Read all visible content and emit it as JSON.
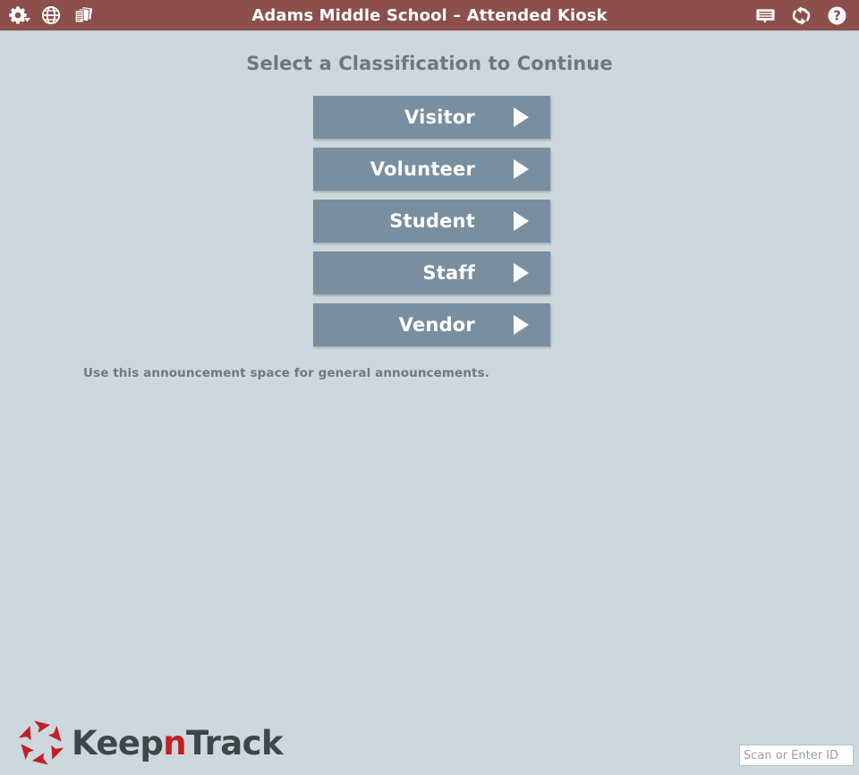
{
  "titlebar": {
    "title": "Adams Middle School – Attended Kiosk",
    "background_color": "#8c4f4c",
    "left_icons": [
      {
        "name": "gear-dropdown-icon",
        "label": "Settings"
      },
      {
        "name": "globe-icon",
        "label": "Language"
      },
      {
        "name": "reports-icon",
        "label": "Reports"
      }
    ],
    "right_icons": [
      {
        "name": "message-icon",
        "label": "Messages"
      },
      {
        "name": "refresh-icon",
        "label": "Refresh"
      },
      {
        "name": "help-icon",
        "label": "Help"
      }
    ]
  },
  "main": {
    "heading": "Select a Classification to Continue",
    "heading_color": "#6b7880",
    "classifications": [
      {
        "label": "Visitor"
      },
      {
        "label": "Volunteer"
      },
      {
        "label": "Student"
      },
      {
        "label": "Staff"
      },
      {
        "label": "Vendor"
      }
    ],
    "button_color": "#798fa0",
    "announcement": "Use this announcement space for general announcements."
  },
  "footer": {
    "logo": {
      "text_part1": "Keep",
      "text_accent": "n",
      "text_part2": "Track",
      "mark_color": "#bf2026",
      "text_color": "#3f4548"
    },
    "scan": {
      "placeholder": "Scan or Enter ID",
      "value": ""
    }
  },
  "page": {
    "background_color": "#ccd8dd"
  }
}
